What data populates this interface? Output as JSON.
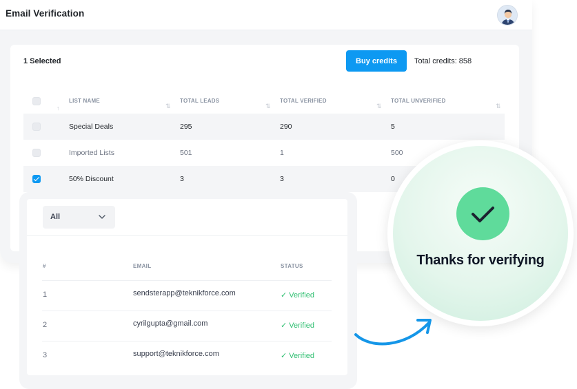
{
  "header": {
    "title": "Email Verification"
  },
  "lists_panel": {
    "selected_label": "1 Selected",
    "buy_button_label": "Buy credits",
    "total_credits_label": "Total credits: 858",
    "columns": [
      "LIST NAME",
      "TOTAL LEADS",
      "TOTAL VERIFIED",
      "TOTAL UNVERIFIED"
    ],
    "rows": [
      {
        "name": "Special Deals",
        "leads": "295",
        "verified": "290",
        "unverified": "5",
        "checked": false
      },
      {
        "name": "Imported Lists",
        "leads": "501",
        "verified": "1",
        "unverified": "500",
        "checked": false
      },
      {
        "name": "50% Discount",
        "leads": "3",
        "verified": "3",
        "unverified": "0",
        "checked": true
      }
    ]
  },
  "emails_panel": {
    "filter_value": "All",
    "columns": [
      "#",
      "EMAIL",
      "STATUS"
    ],
    "rows": [
      {
        "num": "1",
        "email": "sendsterapp@teknikforce.com",
        "status": "✓ Verified"
      },
      {
        "num": "2",
        "email": "cyrilgupta@gmail.com",
        "status": "✓ Verified"
      },
      {
        "num": "3",
        "email": "support@teknikforce.com",
        "status": "✓ Verified"
      }
    ]
  },
  "confirmation": {
    "message": "Thanks for verifying"
  },
  "colors": {
    "accent": "#0d99f2",
    "success": "#2fbf71",
    "check_badge": "#5fdb9b"
  },
  "icons": [
    "user-avatar",
    "sort-icon",
    "checkbox",
    "chevron-down-icon",
    "checkmark-icon",
    "curved-arrow-icon"
  ]
}
